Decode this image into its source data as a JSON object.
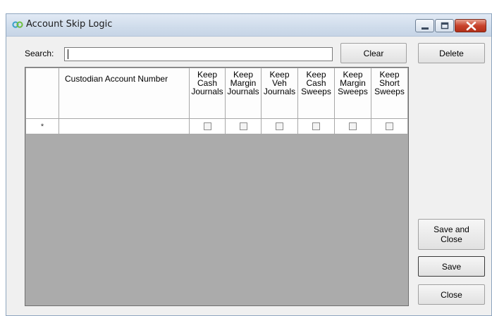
{
  "window": {
    "title": "Account Skip Logic"
  },
  "search": {
    "label": "Search:",
    "value": "",
    "placeholder": ""
  },
  "buttons": {
    "clear": "Clear",
    "delete": "Delete",
    "save_and_close": "Save and Close",
    "save": "Save",
    "close": "Close"
  },
  "grid": {
    "columns": [
      {
        "key": "custodian_account_number",
        "label": "Custodian Account Number"
      },
      {
        "key": "keep_cash_journals",
        "label": "Keep Cash Journals"
      },
      {
        "key": "keep_margin_journals",
        "label": "Keep Margin Journals"
      },
      {
        "key": "keep_veh_journals",
        "label": "Keep Veh Journals"
      },
      {
        "key": "keep_cash_sweeps",
        "label": "Keep Cash Sweeps"
      },
      {
        "key": "keep_margin_sweeps",
        "label": "Keep Margin Sweeps"
      },
      {
        "key": "keep_short_sweeps",
        "label": "Keep Short Sweeps"
      }
    ],
    "new_row_marker": "*",
    "new_row": {
      "custodian_account_number": "",
      "checked": [
        false,
        false,
        false,
        false,
        false,
        false
      ]
    }
  },
  "colors": {
    "grid_empty_area": "#ababab",
    "window_background": "#f0f0f0",
    "close_button": "#c8432c"
  },
  "icons": {
    "app": "infinity-link-icon",
    "minimize": "minimize-icon",
    "maximize": "maximize-icon",
    "close": "close-icon"
  }
}
